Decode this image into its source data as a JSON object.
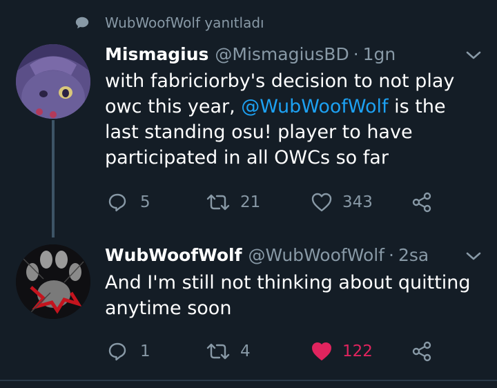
{
  "reply_context": {
    "text": "WubWoofWolf yanıtladı"
  },
  "tweets": [
    {
      "name": "Mismagius",
      "handle": "@MismagiusBD",
      "separator": "·",
      "time": "1gn",
      "text_before": "with fabriciorby's decision to not play owc this year, ",
      "mention": "@WubWoofWolf",
      "text_after": " is the last standing osu! player to have participated in all OWCs so far",
      "replies": "5",
      "retweets": "21",
      "likes": "343",
      "liked": false
    },
    {
      "name": "WubWoofWolf",
      "handle": "@WubWoofWolf",
      "separator": "·",
      "time": "2sa",
      "text": "And I'm still not thinking about quitting anytime soon",
      "replies": "1",
      "retweets": "4",
      "likes": "122",
      "liked": true
    }
  ],
  "colors": {
    "background": "#141d26",
    "secondary_text": "#8899a6",
    "mention": "#1da1f2",
    "like_active": "#e0245e",
    "thread_line": "#3d5466"
  },
  "icons": [
    "comment-bubble-icon",
    "chevron-down-icon",
    "reply-icon",
    "retweet-icon",
    "heart-icon",
    "share-icon"
  ]
}
